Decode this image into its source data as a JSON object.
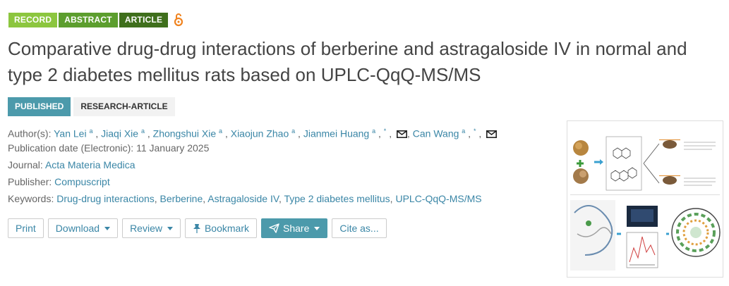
{
  "tags": {
    "record": "RECORD",
    "abstract": "ABSTRACT",
    "article": "ARTICLE"
  },
  "open_access_icon": "open-lock-icon",
  "title": "Comparative drug-drug interactions of berberine and astragaloside IV in normal and type 2 diabetes mellitus rats based on UPLC-QqQ-MS/MS",
  "status": {
    "published": "PUBLISHED",
    "type": "RESEARCH-ARTICLE"
  },
  "meta": {
    "authors_label": "Author(s):",
    "authors": [
      {
        "name": "Yan Lei",
        "sup": "a",
        "corresponding": ""
      },
      {
        "name": "Jiaqi Xie",
        "sup": "a",
        "corresponding": ""
      },
      {
        "name": "Zhongshui Xie",
        "sup": "a",
        "corresponding": ""
      },
      {
        "name": "Xiaojun Zhao",
        "sup": "a",
        "corresponding": ""
      },
      {
        "name": "Jianmei Huang",
        "sup": "a",
        "corresponding": "*"
      },
      {
        "name": "Can Wang",
        "sup": "a",
        "corresponding": "*"
      }
    ],
    "pubdate_label": "Publication date (Electronic):",
    "pubdate": "11 January 2025",
    "journal_label": "Journal:",
    "journal": "Acta Materia Medica",
    "publisher_label": "Publisher:",
    "publisher": "Compuscript",
    "keywords_label": "Keywords:",
    "keywords": [
      "Drug-drug interactions",
      "Berberine",
      "Astragaloside IV",
      "Type 2 diabetes mellitus",
      "UPLC-QqQ-MS/MS"
    ]
  },
  "actions": {
    "print": "Print",
    "download": "Download",
    "review": "Review",
    "bookmark": "Bookmark",
    "share": "Share",
    "cite": "Cite as..."
  },
  "colors": {
    "accent": "#4c9aab",
    "link": "#3a86a6",
    "tag_record": "#8cc63f",
    "tag_abstract": "#5c9e2e",
    "tag_article": "#3f6f1c"
  }
}
